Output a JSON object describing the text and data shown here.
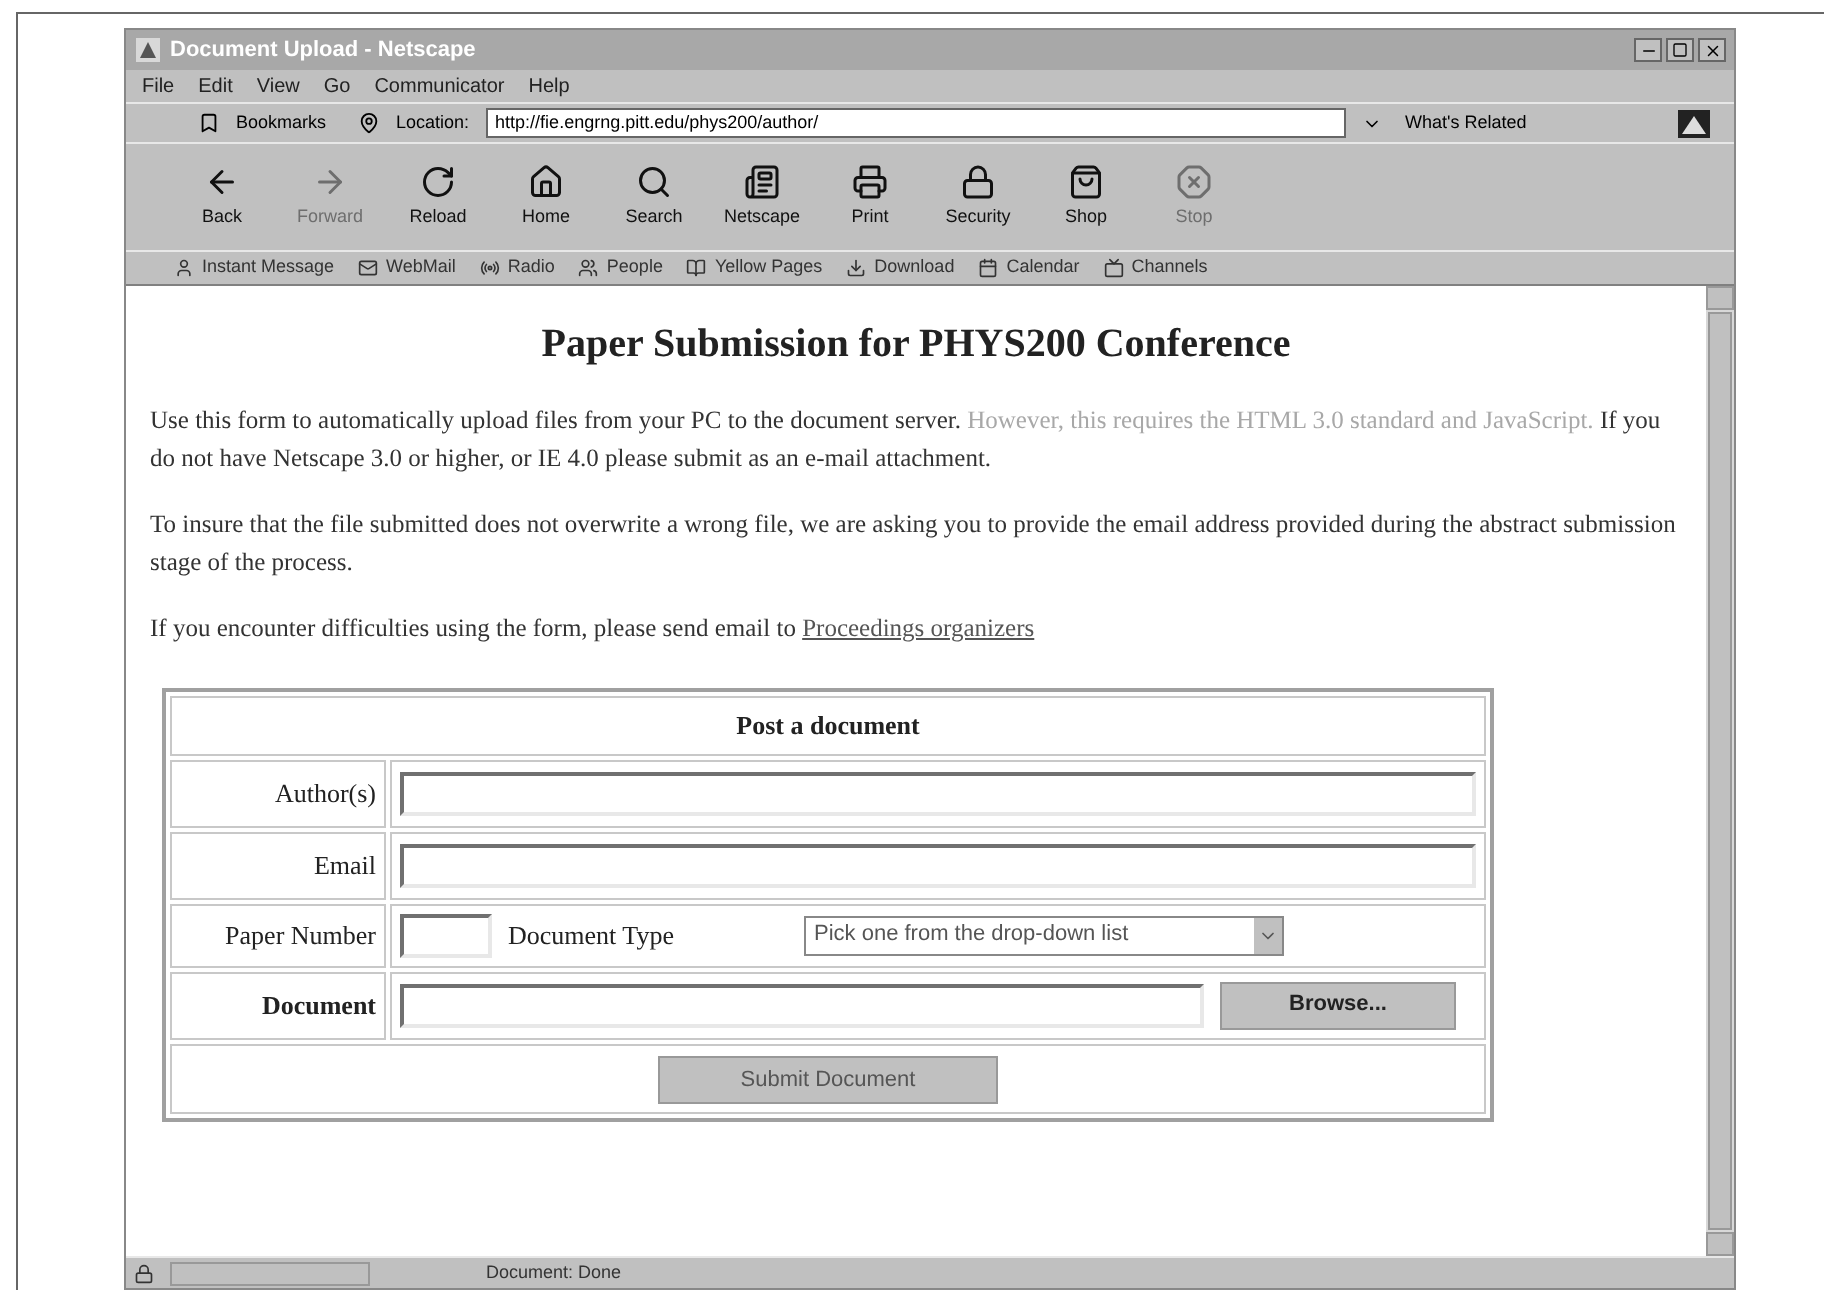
{
  "window": {
    "title": "Document Upload - Netscape"
  },
  "menu": [
    "File",
    "Edit",
    "View",
    "Go",
    "Communicator",
    "Help"
  ],
  "location_bar": {
    "bookmarks": "Bookmarks",
    "label": "Location:",
    "url": "http://fie.engrng.pitt.edu/phys200/author/",
    "related": "What's Related"
  },
  "nav_buttons": [
    {
      "label": "Back",
      "kind": "back",
      "disabled": false
    },
    {
      "label": "Forward",
      "kind": "forward",
      "disabled": true
    },
    {
      "label": "Reload",
      "kind": "reload",
      "disabled": false
    },
    {
      "label": "Home",
      "kind": "home",
      "disabled": false
    },
    {
      "label": "Search",
      "kind": "search",
      "disabled": false
    },
    {
      "label": "Netscape",
      "kind": "netscape",
      "disabled": false
    },
    {
      "label": "Print",
      "kind": "print",
      "disabled": false
    },
    {
      "label": "Security",
      "kind": "security",
      "disabled": false
    },
    {
      "label": "Shop",
      "kind": "shop",
      "disabled": false
    },
    {
      "label": "Stop",
      "kind": "stop",
      "disabled": true
    }
  ],
  "personal_toolbar": [
    "Instant Message",
    "WebMail",
    "Radio",
    "People",
    "Yellow Pages",
    "Download",
    "Calendar",
    "Channels"
  ],
  "page": {
    "heading": "Paper Submission for PHYS200 Conference",
    "paragraphs": [
      [
        {
          "kind": "plain",
          "text": "Use this form to automatically upload files from your PC to the document server. "
        },
        {
          "kind": "muted",
          "text": "However, this requires the HTML 3.0 standard and JavaScript."
        },
        {
          "kind": "plain",
          "text": " If you do not have Netscape 3.0 or higher, or IE 4.0 please submit as an e-mail attachment."
        }
      ],
      [
        {
          "kind": "plain",
          "text": "To insure that the file submitted does not overwrite a wrong file, we are asking you to provide the email address provided during the abstract submission stage of the process."
        }
      ],
      [
        {
          "kind": "plain",
          "text": "If you encounter difficulties using the form, please send email to "
        },
        {
          "kind": "link",
          "text": "Proceedings organizers"
        }
      ]
    ]
  },
  "form": {
    "title": "Post a document",
    "authors_label": "Author(s)",
    "email_label": "Email",
    "paper_number_label": "Paper Number",
    "document_type_label": "Document Type",
    "document_type_value": "Pick one from the drop-down list",
    "document_label": "Document",
    "browse_button": "Browse...",
    "submit_button": "Submit Document"
  },
  "status_bar": {
    "text": "Document: Done"
  }
}
